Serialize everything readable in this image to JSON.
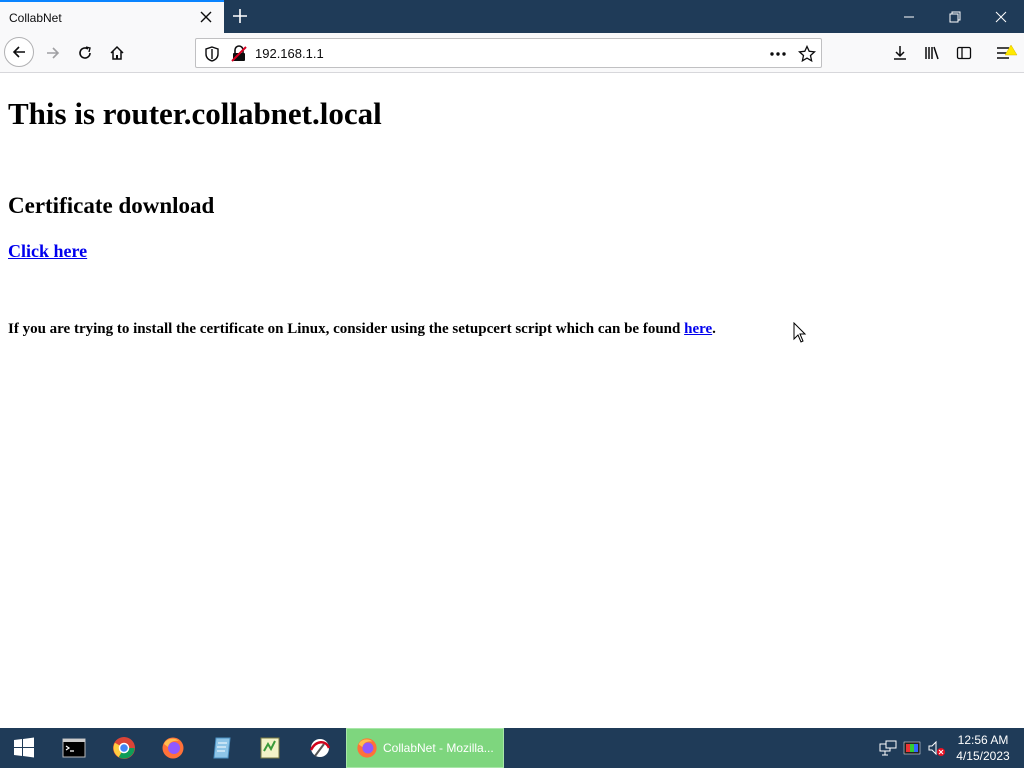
{
  "browser": {
    "tab_title": "CollabNet",
    "url": "192.168.1.1"
  },
  "page": {
    "heading": "This is router.collabnet.local",
    "subheading": "Certificate download",
    "download_link": "Click here",
    "note_text": "If you are trying to install the certificate on Linux, consider using the setupcert script which can be found ",
    "note_link": "here",
    "note_end": "."
  },
  "taskbar": {
    "active_task_label": "CollabNet - Mozilla...",
    "time": "12:56 AM",
    "date": "4/15/2023"
  },
  "colors": {
    "link": "#0000ee",
    "chrome_dark": "#1f3b58",
    "active_task": "#7ed67e"
  }
}
